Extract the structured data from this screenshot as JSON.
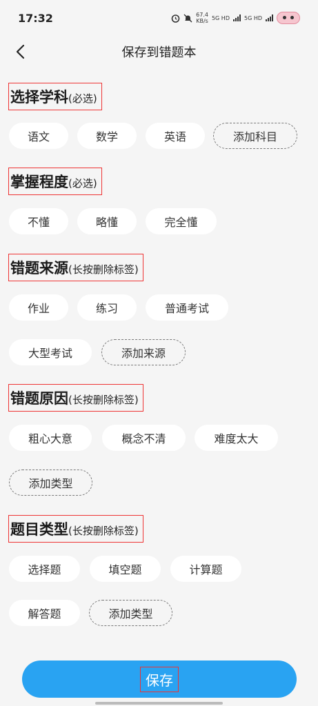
{
  "status_bar": {
    "time": "17:32",
    "speed_value": "67.4",
    "speed_unit": "KB/s",
    "network_1": "5G HD",
    "network_2": "5G HD",
    "icons": [
      "alarm-icon",
      "mute-icon",
      "signal-icon",
      "battery-icon"
    ]
  },
  "nav": {
    "title": "保存到错题本",
    "back_icon": "chevron-left-icon"
  },
  "sections": {
    "subject": {
      "title": "选择学科",
      "hint": "(必选)"
    },
    "mastery": {
      "title": "掌握程度",
      "hint": "(必选)"
    },
    "source": {
      "title": "错题来源",
      "hint": "(长按删除标签)"
    },
    "reason": {
      "title": "错题原因",
      "hint": "(长按删除标签)"
    },
    "qtype": {
      "title": "题目类型",
      "hint": "(长按删除标签)"
    }
  },
  "chips": {
    "subject": [
      "语文",
      "数学",
      "英语"
    ],
    "subject_add": "添加科目",
    "mastery": [
      "不懂",
      "略懂",
      "完全懂"
    ],
    "source": [
      "作业",
      "练习",
      "普通考试",
      "大型考试"
    ],
    "source_add": "添加来源",
    "reason": [
      "粗心大意",
      "概念不清",
      "难度太大"
    ],
    "reason_add": "添加类型",
    "qtype": [
      "选择题",
      "填空题",
      "计算题",
      "解答题"
    ],
    "qtype_add": "添加类型"
  },
  "save_button": {
    "label": "保存"
  },
  "colors": {
    "accent": "#29a3f2",
    "highlight_border": "#ee3333",
    "background": "#f5f5f5"
  }
}
